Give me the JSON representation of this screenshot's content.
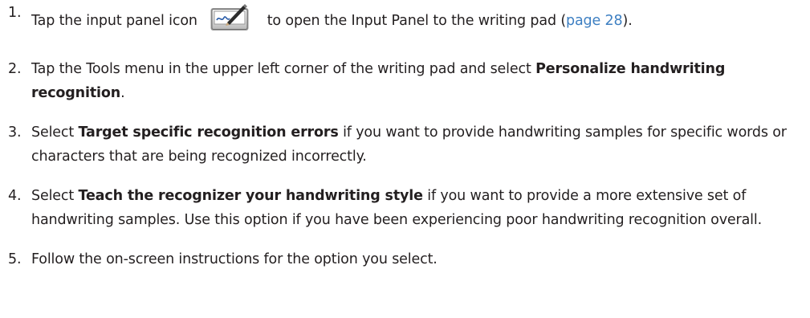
{
  "steps": [
    {
      "number": "1.",
      "text_before_icon": "Tap the input panel icon",
      "icon": "input-panel-pen-icon",
      "text_after_icon": "to open the Input Panel to the writing pad (",
      "link_text": "page 28",
      "text_end": ")."
    },
    {
      "number": "2.",
      "text": "Tap the Tools menu in the upper left corner of the writing pad and select ",
      "bold_text": "Personalize handwriting recognition",
      "text_end": "."
    },
    {
      "number": "3.",
      "text": "Select ",
      "bold_text": "Target specific recognition errors",
      "text_end": " if you want to provide handwriting samples for specific words or characters that are being recognized incorrectly."
    },
    {
      "number": "4.",
      "text": "Select ",
      "bold_text": "Teach the recognizer your handwriting style",
      "text_end": " if you want to provide a more extensive set of handwriting samples. Use this option if you have been experiencing poor handwriting recognition overall."
    },
    {
      "number": "5.",
      "text": "Follow the on-screen instructions for the option you select."
    }
  ],
  "colors": {
    "text": "#231f20",
    "link": "#3d7fc2"
  }
}
